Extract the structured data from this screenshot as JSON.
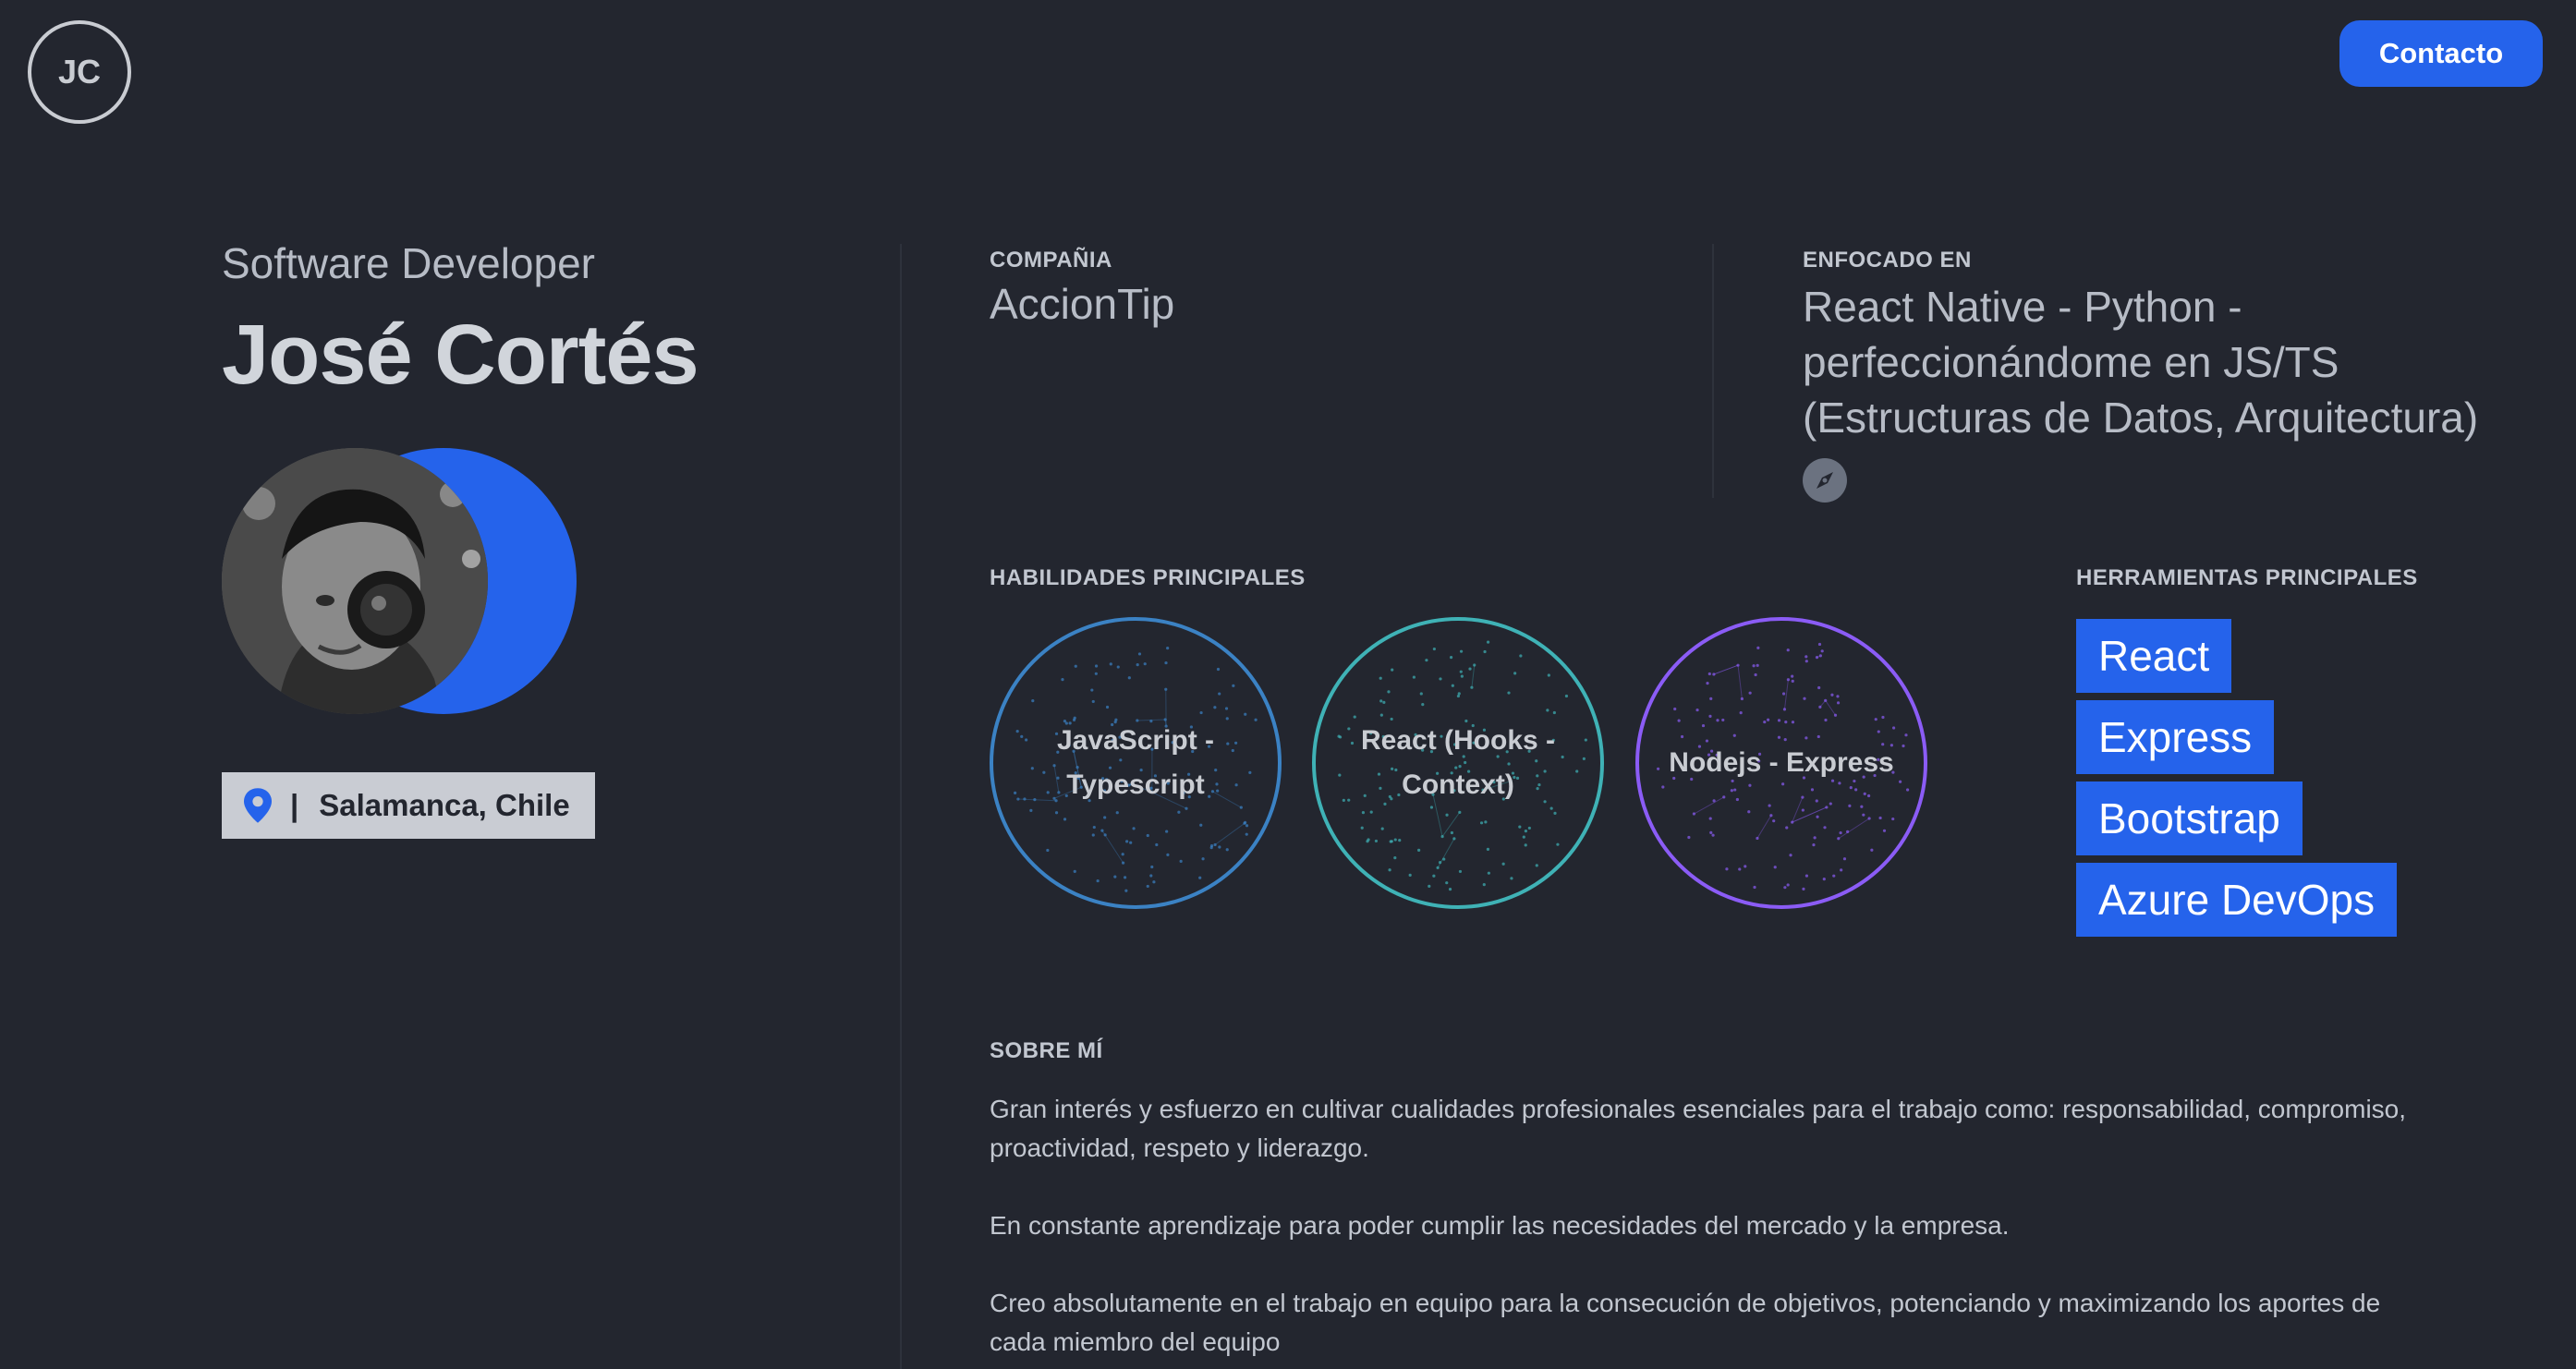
{
  "header": {
    "logo_initials": "JC",
    "contact_label": "Contacto"
  },
  "profile": {
    "role": "Software Developer",
    "name": "José Cortés",
    "location": "Salamanca, Chile"
  },
  "company": {
    "label": "COMPAÑIA",
    "value": "AccionTip"
  },
  "focus": {
    "label": "ENFOCADO EN",
    "value": "React Native - Python - perfeccionándome en JS/TS (Estructuras de Datos, Arquitectura)"
  },
  "skills": {
    "label": "HABILIDADES PRINCIPALES",
    "items": [
      {
        "label": "JavaScript - Typescript",
        "color": "#3b82c4"
      },
      {
        "label": "React (Hooks - Context)",
        "color": "#3fb2b6"
      },
      {
        "label": "Nodejs - Express",
        "color": "#8b5cf6"
      }
    ]
  },
  "tools": {
    "label": "HERRAMIENTAS PRINCIPALES",
    "items": [
      "React",
      "Express",
      "Bootstrap",
      "Azure DevOps"
    ]
  },
  "about": {
    "label": "SOBRE MÍ",
    "paragraphs": [
      "Gran interés y esfuerzo en cultivar cualidades profesionales esenciales para el trabajo como: responsabilidad, compromiso, proactividad, respeto y liderazgo.",
      "En constante aprendizaje para poder cumplir las necesidades del mercado y la empresa.",
      "Creo absolutamente en el trabajo en equipo para la consecución de objetivos, potenciando y maximizando los aportes de cada miembro del equipo"
    ]
  },
  "colors": {
    "accent": "#2563eb",
    "background": "#23262f"
  }
}
